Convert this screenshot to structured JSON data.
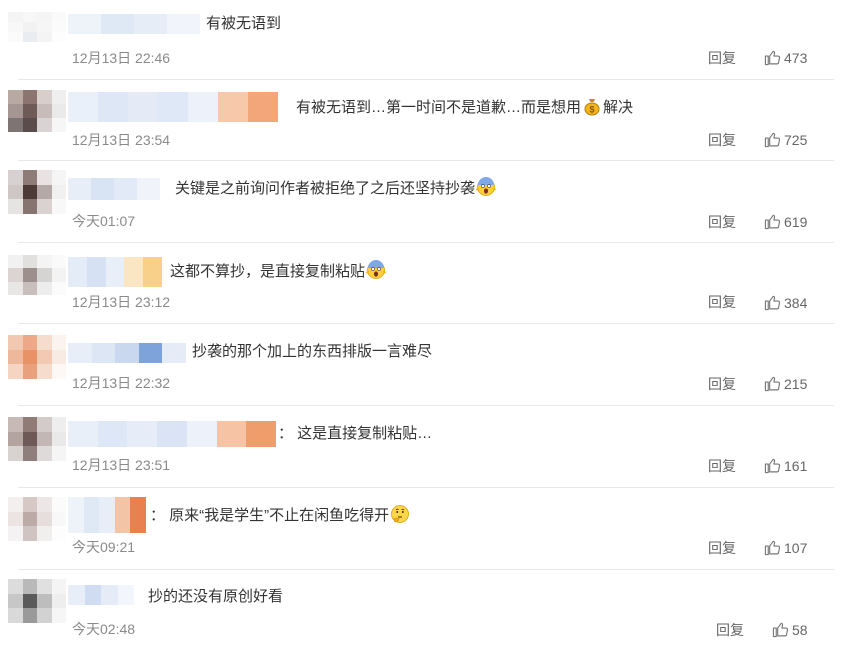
{
  "comments": [
    {
      "text": "有被无语到",
      "time": "12月13日 22:46",
      "reply": "回复",
      "likes": "473"
    },
    {
      "text_before": "有被无语到…第一时间不是道歉…而是想用",
      "emoji": "money-bag",
      "text_after": "解决",
      "time": "12月13日 23:54",
      "reply": "回复",
      "likes": "725"
    },
    {
      "text": "关键是之前询问作者被拒绝了之后还坚持抄袭",
      "emoji": "screaming-face",
      "time": "今天01:07",
      "reply": "回复",
      "likes": "619"
    },
    {
      "text": "这都不算抄，是直接复制粘贴",
      "emoji": "screaming-face",
      "time": "12月13日 23:12",
      "reply": "回复",
      "likes": "384"
    },
    {
      "text": "抄袭的那个加上的东西排版一言难尽",
      "time": "12月13日 22:32",
      "reply": "回复",
      "likes": "215"
    },
    {
      "text": "：  这是直接复制粘贴…",
      "time": "12月13日 23:51",
      "reply": "回复",
      "likes": "161"
    },
    {
      "text": "：  原来“我是学生”不止在闲鱼吃得开",
      "emoji": "thinking-face",
      "time": "今天09:21",
      "reply": "回复",
      "likes": "107"
    },
    {
      "text": "抄的还没有原创好看",
      "time": "今天02:48",
      "reply": "回复",
      "likes": "58"
    }
  ],
  "colors": {
    "text": "#333333",
    "meta": "#8a8a8a",
    "divider": "#e8e8e8",
    "username_blur": "#dbe6f5"
  }
}
